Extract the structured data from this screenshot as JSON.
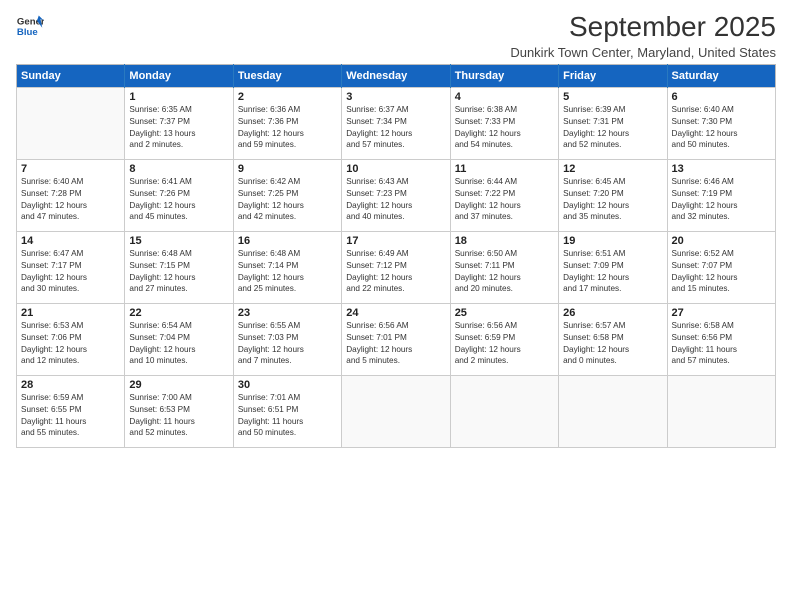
{
  "logo": {
    "line1": "General",
    "line2": "Blue"
  },
  "title": "September 2025",
  "subtitle": "Dunkirk Town Center, Maryland, United States",
  "days_header": [
    "Sunday",
    "Monday",
    "Tuesday",
    "Wednesday",
    "Thursday",
    "Friday",
    "Saturday"
  ],
  "weeks": [
    [
      {
        "num": "",
        "info": ""
      },
      {
        "num": "1",
        "info": "Sunrise: 6:35 AM\nSunset: 7:37 PM\nDaylight: 13 hours\nand 2 minutes."
      },
      {
        "num": "2",
        "info": "Sunrise: 6:36 AM\nSunset: 7:36 PM\nDaylight: 12 hours\nand 59 minutes."
      },
      {
        "num": "3",
        "info": "Sunrise: 6:37 AM\nSunset: 7:34 PM\nDaylight: 12 hours\nand 57 minutes."
      },
      {
        "num": "4",
        "info": "Sunrise: 6:38 AM\nSunset: 7:33 PM\nDaylight: 12 hours\nand 54 minutes."
      },
      {
        "num": "5",
        "info": "Sunrise: 6:39 AM\nSunset: 7:31 PM\nDaylight: 12 hours\nand 52 minutes."
      },
      {
        "num": "6",
        "info": "Sunrise: 6:40 AM\nSunset: 7:30 PM\nDaylight: 12 hours\nand 50 minutes."
      }
    ],
    [
      {
        "num": "7",
        "info": "Sunrise: 6:40 AM\nSunset: 7:28 PM\nDaylight: 12 hours\nand 47 minutes."
      },
      {
        "num": "8",
        "info": "Sunrise: 6:41 AM\nSunset: 7:26 PM\nDaylight: 12 hours\nand 45 minutes."
      },
      {
        "num": "9",
        "info": "Sunrise: 6:42 AM\nSunset: 7:25 PM\nDaylight: 12 hours\nand 42 minutes."
      },
      {
        "num": "10",
        "info": "Sunrise: 6:43 AM\nSunset: 7:23 PM\nDaylight: 12 hours\nand 40 minutes."
      },
      {
        "num": "11",
        "info": "Sunrise: 6:44 AM\nSunset: 7:22 PM\nDaylight: 12 hours\nand 37 minutes."
      },
      {
        "num": "12",
        "info": "Sunrise: 6:45 AM\nSunset: 7:20 PM\nDaylight: 12 hours\nand 35 minutes."
      },
      {
        "num": "13",
        "info": "Sunrise: 6:46 AM\nSunset: 7:19 PM\nDaylight: 12 hours\nand 32 minutes."
      }
    ],
    [
      {
        "num": "14",
        "info": "Sunrise: 6:47 AM\nSunset: 7:17 PM\nDaylight: 12 hours\nand 30 minutes."
      },
      {
        "num": "15",
        "info": "Sunrise: 6:48 AM\nSunset: 7:15 PM\nDaylight: 12 hours\nand 27 minutes."
      },
      {
        "num": "16",
        "info": "Sunrise: 6:48 AM\nSunset: 7:14 PM\nDaylight: 12 hours\nand 25 minutes."
      },
      {
        "num": "17",
        "info": "Sunrise: 6:49 AM\nSunset: 7:12 PM\nDaylight: 12 hours\nand 22 minutes."
      },
      {
        "num": "18",
        "info": "Sunrise: 6:50 AM\nSunset: 7:11 PM\nDaylight: 12 hours\nand 20 minutes."
      },
      {
        "num": "19",
        "info": "Sunrise: 6:51 AM\nSunset: 7:09 PM\nDaylight: 12 hours\nand 17 minutes."
      },
      {
        "num": "20",
        "info": "Sunrise: 6:52 AM\nSunset: 7:07 PM\nDaylight: 12 hours\nand 15 minutes."
      }
    ],
    [
      {
        "num": "21",
        "info": "Sunrise: 6:53 AM\nSunset: 7:06 PM\nDaylight: 12 hours\nand 12 minutes."
      },
      {
        "num": "22",
        "info": "Sunrise: 6:54 AM\nSunset: 7:04 PM\nDaylight: 12 hours\nand 10 minutes."
      },
      {
        "num": "23",
        "info": "Sunrise: 6:55 AM\nSunset: 7:03 PM\nDaylight: 12 hours\nand 7 minutes."
      },
      {
        "num": "24",
        "info": "Sunrise: 6:56 AM\nSunset: 7:01 PM\nDaylight: 12 hours\nand 5 minutes."
      },
      {
        "num": "25",
        "info": "Sunrise: 6:56 AM\nSunset: 6:59 PM\nDaylight: 12 hours\nand 2 minutes."
      },
      {
        "num": "26",
        "info": "Sunrise: 6:57 AM\nSunset: 6:58 PM\nDaylight: 12 hours\nand 0 minutes."
      },
      {
        "num": "27",
        "info": "Sunrise: 6:58 AM\nSunset: 6:56 PM\nDaylight: 11 hours\nand 57 minutes."
      }
    ],
    [
      {
        "num": "28",
        "info": "Sunrise: 6:59 AM\nSunset: 6:55 PM\nDaylight: 11 hours\nand 55 minutes."
      },
      {
        "num": "29",
        "info": "Sunrise: 7:00 AM\nSunset: 6:53 PM\nDaylight: 11 hours\nand 52 minutes."
      },
      {
        "num": "30",
        "info": "Sunrise: 7:01 AM\nSunset: 6:51 PM\nDaylight: 11 hours\nand 50 minutes."
      },
      {
        "num": "",
        "info": ""
      },
      {
        "num": "",
        "info": ""
      },
      {
        "num": "",
        "info": ""
      },
      {
        "num": "",
        "info": ""
      }
    ]
  ]
}
